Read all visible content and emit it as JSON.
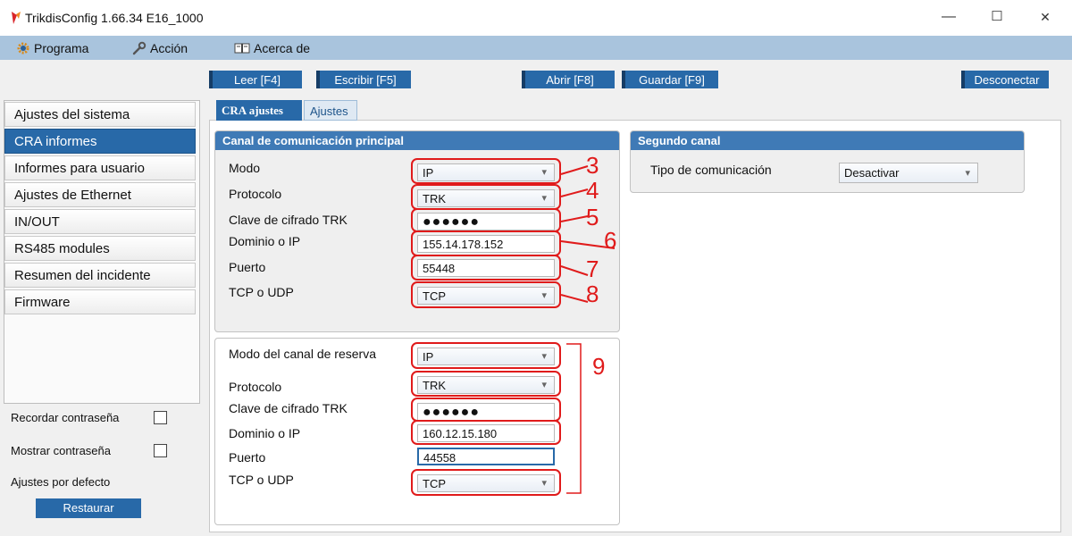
{
  "window": {
    "title": "TrikdisConfig 1.66.34   E16_1000",
    "minimize": "—",
    "maximize": "☐",
    "close": "✕"
  },
  "menu": {
    "programa": "Programa",
    "accion": "Acción",
    "acerca": "Acerca de"
  },
  "toolbar": {
    "leer": "Leer [F4]",
    "escribir": "Escribir [F5]",
    "abrir": "Abrir [F8]",
    "guardar": "Guardar [F9]",
    "desconectar": "Desconectar"
  },
  "sidebar": {
    "items": [
      "Ajustes del sistema",
      "CRA informes",
      "Informes para usuario",
      "Ajustes de Ethernet",
      "IN/OUT",
      "RS485 modules",
      "Resumen del incidente",
      "Firmware"
    ],
    "active_index": 1,
    "remember_password": "Recordar contraseña",
    "show_password": "Mostrar contraseña",
    "defaults": "Ajustes por defecto",
    "restore": "Restaurar"
  },
  "tabs": {
    "cra": "CRA ajustes",
    "ajustes": "Ajustes"
  },
  "primary": {
    "title": "Canal de comunicación principal",
    "labels": {
      "modo": "Modo",
      "protocolo": "Protocolo",
      "clave": "Clave de cifrado TRK",
      "dominio": "Dominio o IP",
      "puerto": "Puerto",
      "tcp": "TCP o UDP"
    },
    "values": {
      "modo": "IP",
      "protocolo": "TRK",
      "clave": "●●●●●●",
      "dominio": "155.14.178.152",
      "puerto": "55448",
      "tcp": "TCP"
    }
  },
  "backup": {
    "labels": {
      "modo": "Modo del canal de reserva",
      "protocolo": "Protocolo",
      "clave": "Clave de cifrado TRK",
      "dominio": "Dominio o IP",
      "puerto": "Puerto",
      "tcp": "TCP o UDP"
    },
    "values": {
      "modo": "IP",
      "protocolo": "TRK",
      "clave": "●●●●●●",
      "dominio": "160.12.15.180",
      "puerto": "44558",
      "tcp": "TCP"
    }
  },
  "second": {
    "title": "Segundo canal",
    "tipo_label": "Tipo de comunicación",
    "tipo_value": "Desactivar"
  },
  "annotations": [
    "3",
    "4",
    "5",
    "6",
    "7",
    "8",
    "9"
  ],
  "colors": {
    "accent": "#2869a8",
    "menubar": "#a9c4dd",
    "annotation": "#e01b1b"
  }
}
